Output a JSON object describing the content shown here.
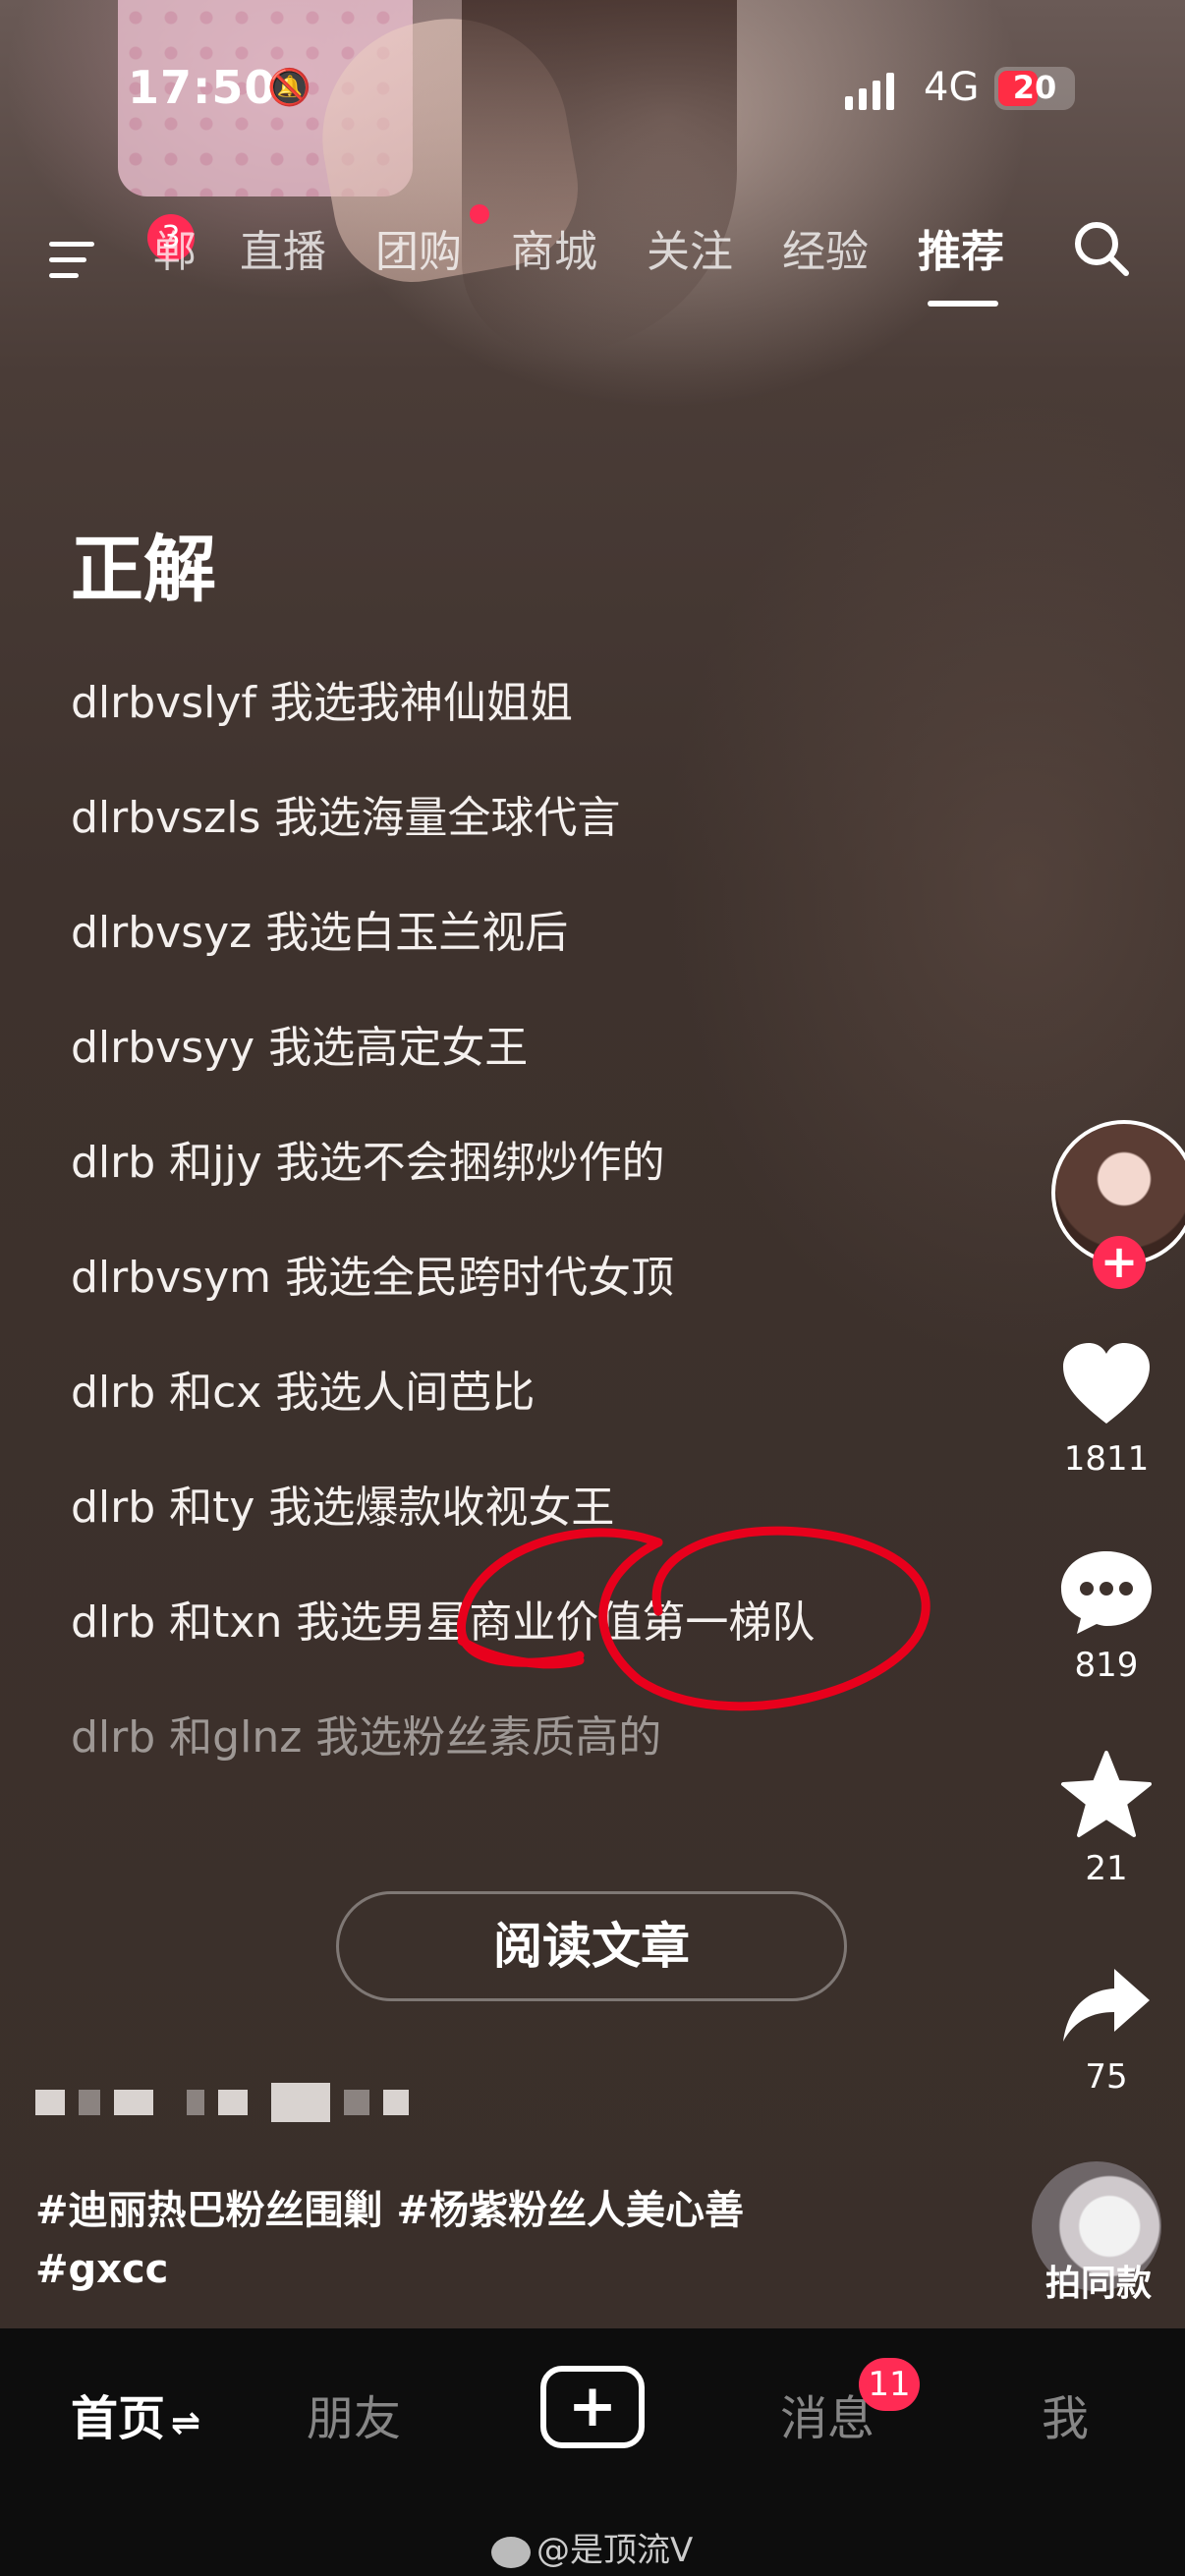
{
  "status_bar": {
    "time": "17:50",
    "network": "4G",
    "battery": "20"
  },
  "top_nav": {
    "menu_badge": "3",
    "tabs": [
      {
        "label": "郸"
      },
      {
        "label": "直播"
      },
      {
        "label": "团购"
      },
      {
        "label": "商城"
      },
      {
        "label": "关注"
      },
      {
        "label": "经验"
      },
      {
        "label": "推荐"
      }
    ],
    "active_tab": "推荐"
  },
  "article": {
    "headline": "正解",
    "lines": [
      "dlrbvslyf 我选我神仙姐姐",
      "dlrbvszls 我选海量全球代言",
      "dlrbvsyz 我选白玉兰视后",
      "dlrbvsyy 我选高定女王",
      "dlrb 和jjy 我选不会捆绑炒作的",
      "dlrbvsym 我选全民跨时代女顶",
      "dlrb 和cx 我选人间芭比",
      "dlrb 和ty 我选爆款收视女王",
      "dlrb 和txn 我选男星商业价值第一梯队",
      "dlrb 和glnz 我选粉丝素质高的"
    ],
    "read_button": "阅读文章"
  },
  "actions": {
    "likes": "1811",
    "comments": "819",
    "favorites": "21",
    "shares": "75"
  },
  "caption": {
    "line1": "#迪丽热巴粉丝围剿 #杨紫粉丝人美心善",
    "line2": "#gxcc"
  },
  "music_label": "拍同款",
  "bottom_nav": {
    "home": "首页",
    "friends": "朋友",
    "messages": "消息",
    "messages_badge": "11",
    "me": "我"
  },
  "watermark": "@是顶流V",
  "colors": {
    "accent": "#ff2b54",
    "scribble": "#e8001c"
  }
}
